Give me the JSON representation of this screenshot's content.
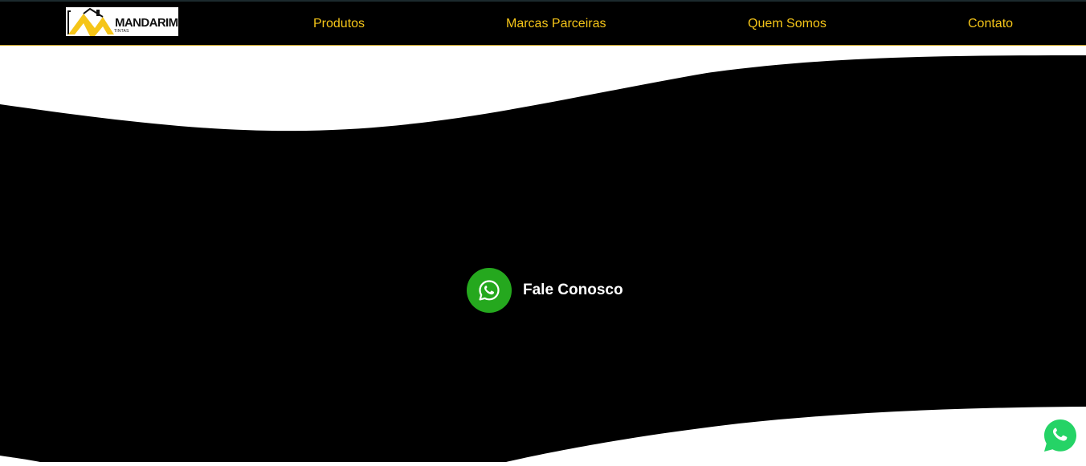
{
  "brand": {
    "logo_text": "MANDARIM",
    "logo_subtext": "TINTAS",
    "logo_accent_color": "#f5c518"
  },
  "nav": {
    "items": [
      {
        "label": "Produtos"
      },
      {
        "label": "Marcas Parceiras"
      },
      {
        "label": "Quem Somos"
      },
      {
        "label": "Contato"
      }
    ],
    "link_color": "#f5c518"
  },
  "hero": {
    "background_color": "#000000",
    "cta_label": "Fale Conosco",
    "cta_icon": "whatsapp-icon",
    "cta_icon_color": "#25a81e"
  },
  "floating_button": {
    "icon": "whatsapp-icon",
    "color": "#25d366"
  }
}
